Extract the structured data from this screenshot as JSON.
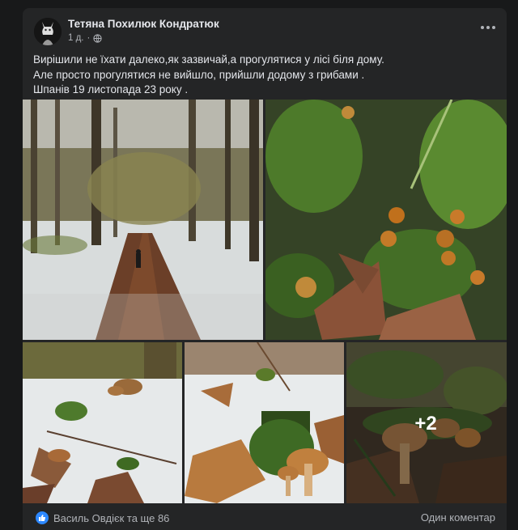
{
  "post": {
    "author": "Тетяна Похилюк Кондратюк",
    "time": "1 д.",
    "privacy_icon": "globe-icon",
    "text_lines": [
      "Вирішили не їхати далеко,як зазвичай,а прогулятися у лісі біля дому.",
      "Але просто прогулятися не вийшло, прийшли додому з грибами .",
      "Шпанів 19 листопада 23 року ."
    ],
    "more_photos_label": "+2"
  },
  "footer": {
    "reactions_text": "Василь Овдієк та ще 86",
    "comments_text": "Один коментар"
  },
  "colors": {
    "card_bg": "#242526",
    "page_bg": "#18191a",
    "like_blue": "#2d88ff"
  }
}
